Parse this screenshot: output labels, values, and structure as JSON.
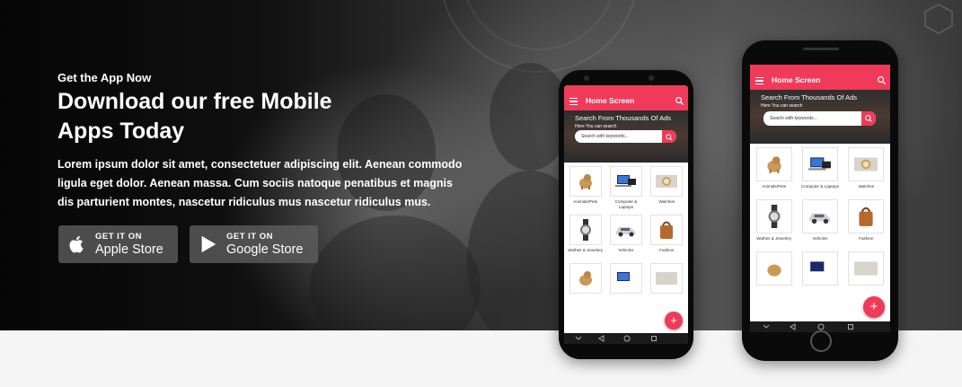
{
  "hero": {
    "eyebrow": "Get the App Now",
    "headline": "Download our free Mobile Apps Today",
    "description": "Lorem ipsum dolor sit amet, consectetuer adipiscing elit. Aenean commodo ligula eget dolor. Aenean massa. Cum sociis natoque penatibus et magnis dis parturient montes, nascetur ridiculus mus nascetur ridiculus mus."
  },
  "stores": {
    "apple": {
      "small": "GET IT ON",
      "big": "Apple Store",
      "icon": "apple-icon"
    },
    "google": {
      "small": "GET IT ON",
      "big": "Google Store",
      "icon": "play-icon"
    }
  },
  "app_preview": {
    "screen_title": "Home Screen",
    "banner_title": "Search From Thousands Of Ads",
    "banner_sub": "Here You can search",
    "search_placeholder": "Search with keywords...",
    "fab_label": "+",
    "categories": [
      {
        "label": "Animals/Pets",
        "icon": "dog-icon"
      },
      {
        "label": "Computer & Laptops",
        "icon": "computer-icon"
      },
      {
        "label": "Watches",
        "icon": "watch-icon"
      },
      {
        "label": "Wathes & Jewelery",
        "icon": "wristwatch-icon"
      },
      {
        "label": "Vehicles",
        "icon": "car-icon"
      },
      {
        "label": "Fashion",
        "icon": "bag-icon"
      }
    ]
  },
  "colors": {
    "accent": "#f03a5a",
    "hero_bg": "#1a1a1a",
    "button_bg": "#5f5f5f"
  }
}
